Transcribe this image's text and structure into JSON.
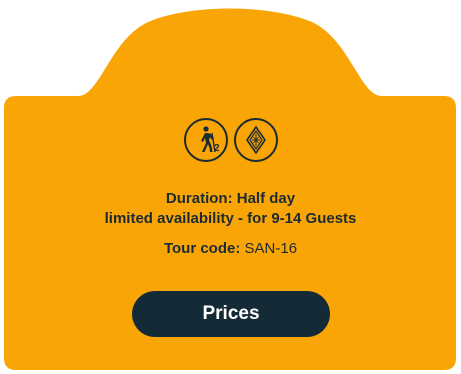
{
  "card": {
    "background_color": "#f9a505",
    "icons": [
      {
        "name": "hiking-level-icon",
        "badge": "2"
      },
      {
        "name": "cultural-tour-icon"
      }
    ],
    "duration_text": "Duration: Half day",
    "availability_text": "limited availability - for 9-14 Guests",
    "tour_code_label": "Tour code:",
    "tour_code_value": "SAN-16",
    "prices_button_label": "Prices",
    "button_color": "#142a36"
  }
}
